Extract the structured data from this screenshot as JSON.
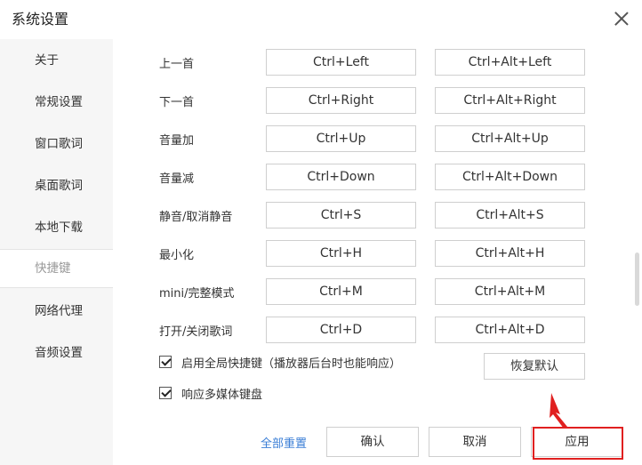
{
  "window": {
    "title": "系统设置"
  },
  "sidebar": {
    "items": [
      {
        "label": "关于"
      },
      {
        "label": "常规设置"
      },
      {
        "label": "窗口歌词"
      },
      {
        "label": "桌面歌词"
      },
      {
        "label": "本地下载"
      },
      {
        "label": "快捷键"
      },
      {
        "label": "网络代理"
      },
      {
        "label": "音频设置"
      }
    ],
    "active": "快捷键"
  },
  "shortcuts": [
    {
      "label": "上一首",
      "local": "Ctrl+Left",
      "global": "Ctrl+Alt+Left"
    },
    {
      "label": "下一首",
      "local": "Ctrl+Right",
      "global": "Ctrl+Alt+Right"
    },
    {
      "label": "音量加",
      "local": "Ctrl+Up",
      "global": "Ctrl+Alt+Up"
    },
    {
      "label": "音量减",
      "local": "Ctrl+Down",
      "global": "Ctrl+Alt+Down"
    },
    {
      "label": "静音/取消静音",
      "local": "Ctrl+S",
      "global": "Ctrl+Alt+S"
    },
    {
      "label": "最小化",
      "local": "Ctrl+H",
      "global": "Ctrl+Alt+H"
    },
    {
      "label": "mini/完整模式",
      "local": "Ctrl+M",
      "global": "Ctrl+Alt+M"
    },
    {
      "label": "打开/关闭歌词",
      "local": "Ctrl+D",
      "global": "Ctrl+Alt+D"
    }
  ],
  "options": {
    "global_hotkeys": {
      "label": "启用全局快捷键（播放器后台时也能响应）",
      "checked": true
    },
    "media_keys": {
      "label": "响应多媒体键盘",
      "checked": true
    }
  },
  "buttons": {
    "restore_default": "恢复默认",
    "reset_all": "全部重置",
    "ok": "确认",
    "cancel": "取消",
    "apply": "应用"
  },
  "colors": {
    "link": "#3a7ed6",
    "highlight": "#e02020",
    "sidebar_bg": "#f6f6f6"
  }
}
